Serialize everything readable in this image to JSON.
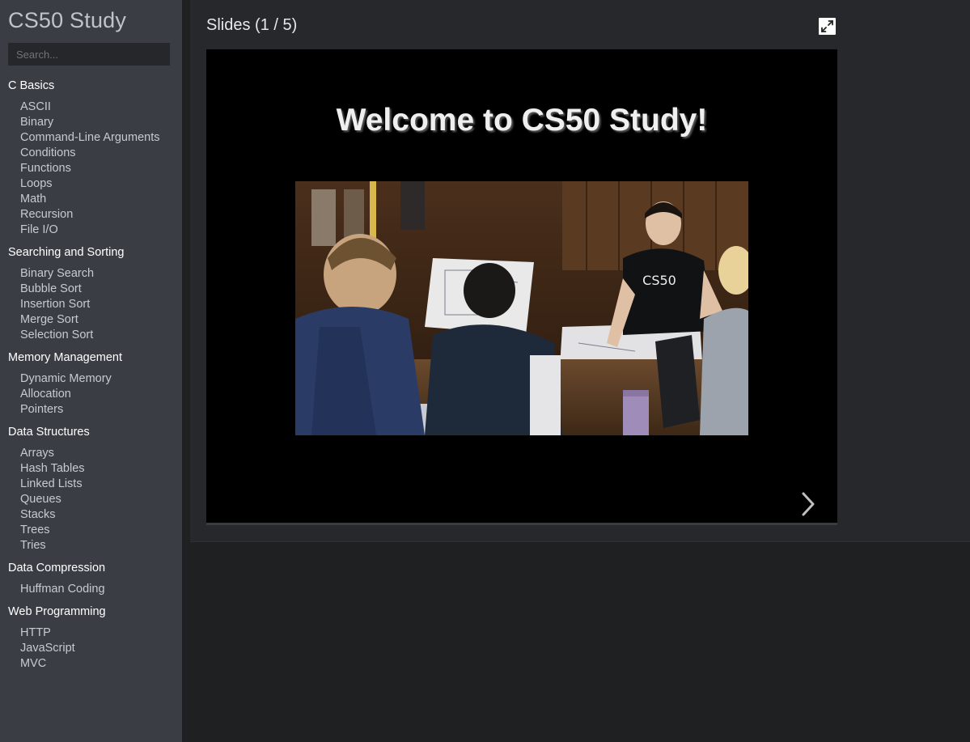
{
  "sidebar": {
    "brand": "CS50 Study",
    "search_placeholder": "Search...",
    "sections": [
      {
        "title": "C Basics",
        "items": [
          "ASCII",
          "Binary",
          "Command-Line Arguments",
          "Conditions",
          "Functions",
          "Loops",
          "Math",
          "Recursion",
          "File I/O"
        ]
      },
      {
        "title": "Searching and Sorting",
        "items": [
          "Binary Search",
          "Bubble Sort",
          "Insertion Sort",
          "Merge Sort",
          "Selection Sort"
        ]
      },
      {
        "title": "Memory Management",
        "items": [
          "Dynamic Memory",
          "Allocation",
          "Pointers"
        ]
      },
      {
        "title": "Data Structures",
        "items": [
          "Arrays",
          "Hash Tables",
          "Linked Lists",
          "Queues",
          "Stacks",
          "Trees",
          "Tries"
        ]
      },
      {
        "title": "Data Compression",
        "items": [
          "Huffman Coding"
        ]
      },
      {
        "title": "Web Programming",
        "items": [
          "HTTP",
          "JavaScript",
          "MVC"
        ]
      }
    ]
  },
  "main": {
    "slides_title": "Slides (1 / 5)",
    "slide": {
      "heading": "Welcome to CS50 Study!"
    },
    "icons": {
      "fullscreen": "expand-icon",
      "next": "chevron-right-icon"
    }
  }
}
